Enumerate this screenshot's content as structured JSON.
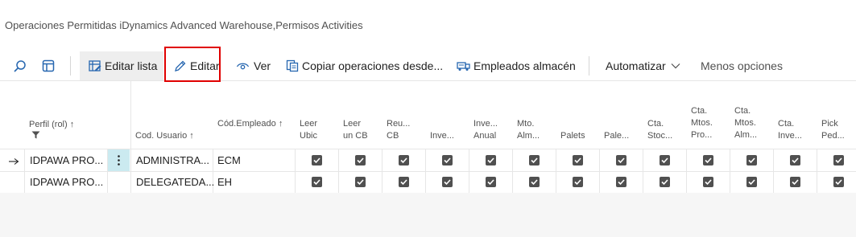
{
  "page": {
    "title": "Operaciones Permitidas iDynamics Advanced Warehouse,Permisos Activities"
  },
  "toolbar": {
    "search_icon": "search-icon",
    "layout_icon": "layout-icon",
    "editar_lista": "Editar lista",
    "editar": "Editar",
    "ver": "Ver",
    "copiar": "Copiar operaciones desde...",
    "empleados": "Empleados almacén",
    "automatizar": "Automatizar",
    "menos": "Menos opciones"
  },
  "table": {
    "columns": [
      {
        "key": "perfil",
        "label": "Perfil (rol) ↑"
      },
      {
        "key": "cod_usuario",
        "label": "Cod. Usuario ↑"
      },
      {
        "key": "cod_empleado",
        "label": "Cód.Empleado ↑"
      },
      {
        "key": "leer_ubic",
        "label": "Leer Ubic"
      },
      {
        "key": "leer_cb",
        "label": "Leer un CB"
      },
      {
        "key": "reu_cb",
        "label": "Reu... CB"
      },
      {
        "key": "inve1",
        "label": "Inve..."
      },
      {
        "key": "inve_anual",
        "label": "Inve... Anual"
      },
      {
        "key": "mto_alm",
        "label": "Mto. Alm..."
      },
      {
        "key": "palets",
        "label": "Palets"
      },
      {
        "key": "pale",
        "label": "Pale..."
      },
      {
        "key": "cta_stoc",
        "label": "Cta. Stoc..."
      },
      {
        "key": "cta_mtos_pro",
        "label": "Cta. Mtos. Pro..."
      },
      {
        "key": "cta_mtos_alm",
        "label": "Cta. Mtos. Alm..."
      },
      {
        "key": "cta_inve",
        "label": "Cta. Inve..."
      },
      {
        "key": "pick_ped",
        "label": "Pick Ped..."
      }
    ],
    "filter_icon": "filter-icon",
    "rows": [
      {
        "arrow": "→",
        "perfil": "IDPAWA PRO...",
        "cod_usuario": "ADMINISTRA...",
        "cod_empleado": "ECM",
        "checks": [
          true,
          true,
          true,
          true,
          true,
          true,
          true,
          true,
          true,
          true,
          true,
          true,
          true
        ]
      },
      {
        "arrow": "",
        "perfil": "IDPAWA PRO...",
        "cod_usuario": "DELEGATEDA...",
        "cod_empleado": "EH",
        "checks": [
          true,
          true,
          true,
          true,
          true,
          true,
          true,
          true,
          true,
          true,
          true,
          true,
          true
        ]
      }
    ]
  }
}
